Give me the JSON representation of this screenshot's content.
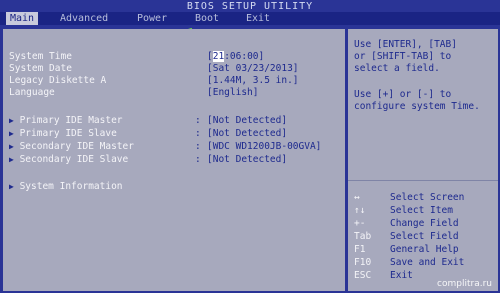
{
  "title": "BIOS SETUP UTILITY",
  "menu": [
    {
      "label": "Main",
      "active": true
    },
    {
      "label": "Advanced",
      "active": false
    },
    {
      "label": "Power",
      "active": false
    },
    {
      "label": "Boot",
      "active": false
    },
    {
      "label": "Exit",
      "active": false
    }
  ],
  "settings": {
    "system_time": {
      "label": "System Time",
      "value_cursor": "21",
      "value_rest": ":06:00]",
      "value_open": "["
    },
    "system_date": {
      "label": "System Date",
      "value": "[Sat 03/23/2013]"
    },
    "legacy_diskette": {
      "label": "Legacy Diskette A",
      "value": "[1.44M, 3.5 in.]"
    },
    "language": {
      "label": "Language",
      "value": "[English]"
    }
  },
  "ide": [
    {
      "label": "Primary IDE Master",
      "value": "[Not Detected]"
    },
    {
      "label": "Primary IDE Slave",
      "value": "[Not Detected]"
    },
    {
      "label": "Secondary IDE Master",
      "value": "[WDC WD1200JB-00GVA]"
    },
    {
      "label": "Secondary IDE Slave",
      "value": "[Not Detected]"
    }
  ],
  "system_information": {
    "label": "System Information"
  },
  "colon": ":",
  "submenu_marker": "▶",
  "help": {
    "lines1": [
      "Use [ENTER], [TAB]",
      "or [SHIFT-TAB] to",
      "select a field."
    ],
    "lines2": [
      "Use [+] or [-] to",
      "configure system Time."
    ]
  },
  "keys": [
    {
      "key": "↔",
      "desc": "Select Screen"
    },
    {
      "key": "↑↓",
      "desc": "Select Item"
    },
    {
      "key": "+-",
      "desc": "Change Field"
    },
    {
      "key": "Tab",
      "desc": "Select Field"
    },
    {
      "key": "F1",
      "desc": "General Help"
    },
    {
      "key": "F10",
      "desc": "Save and Exit"
    },
    {
      "key": "ESC",
      "desc": "Exit"
    }
  ],
  "watermark": "complitra.ru",
  "colors": {
    "background": "#2a3496",
    "panel": "#a7a9bd",
    "label_text": "#f4f4f8",
    "value_text": "#1e2a8e",
    "pointer_arrow": "#7cf03a"
  }
}
